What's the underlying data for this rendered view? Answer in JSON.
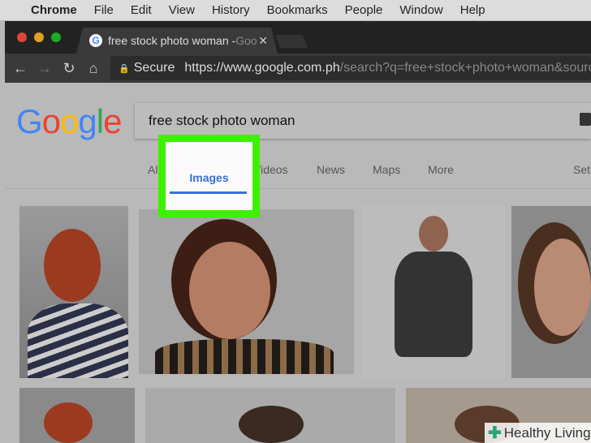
{
  "menubar": {
    "apple": "",
    "items": [
      "Chrome",
      "File",
      "Edit",
      "View",
      "History",
      "Bookmarks",
      "People",
      "Window",
      "Help"
    ]
  },
  "browser": {
    "tab_title": "free stock photo woman - ",
    "tab_title_faded": "Goo",
    "tab_close": "✕",
    "back": "←",
    "forward": "→",
    "reload": "↻",
    "home": "⌂",
    "lock": "🔒",
    "secure": "Secure",
    "url_host": "https://www.google.com.ph",
    "url_path": "/search?q=free+stock+photo+woman&sourc"
  },
  "google": {
    "logo": [
      "G",
      "o",
      "o",
      "g",
      "l",
      "e"
    ],
    "logo_colors": [
      "#4285f4",
      "#ea4335",
      "#fbbc05",
      "#4285f4",
      "#34a853",
      "#ea4335"
    ],
    "query": "free stock photo woman",
    "tabs": {
      "all": "All",
      "images": "Images",
      "videos": "Videos",
      "news": "News",
      "maps": "Maps",
      "more": "More",
      "settings": "Set"
    }
  },
  "highlight_color": "#3ef000",
  "watermark": {
    "icon": "✚",
    "text": "Healthy Living"
  }
}
